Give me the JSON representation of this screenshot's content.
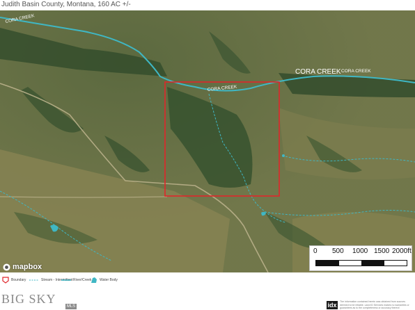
{
  "header": {
    "title": "Judith Basin County, Montana, 160 AC +/-"
  },
  "map": {
    "labels": {
      "creek_top_left": "CORA CREEK",
      "creek_main": "CORA CREEK",
      "creek_main_small": "CORA CREEK",
      "creek_parcel": "CORA CREEK"
    },
    "attribution": "mapbox",
    "colors": {
      "water": "#3fb7c4",
      "parcel_boundary": "#e0262b",
      "terrain_dark": "#2f4a2a",
      "terrain_light": "#8f8a5e"
    }
  },
  "scale": {
    "ticks": [
      "0",
      "500",
      "1000",
      "1500",
      "2000ft"
    ]
  },
  "legend": {
    "items": [
      {
        "label": "Boundary",
        "icon": "boundary-icon"
      },
      {
        "label": "Stream - Intermittent",
        "icon": "stream-icon"
      },
      {
        "label": "River/Creek",
        "icon": "river-icon"
      },
      {
        "label": "Water Body",
        "icon": "water-body-icon"
      }
    ]
  },
  "footer": {
    "brand": "BIG SKY",
    "brand_sub": "MLS",
    "idx": "idx",
    "disclaimer": "The information contained herein was obtained from sources deemed to be reliable. Land ID Services makes no warranties or guarantees as to the completeness or accuracy thereof."
  }
}
